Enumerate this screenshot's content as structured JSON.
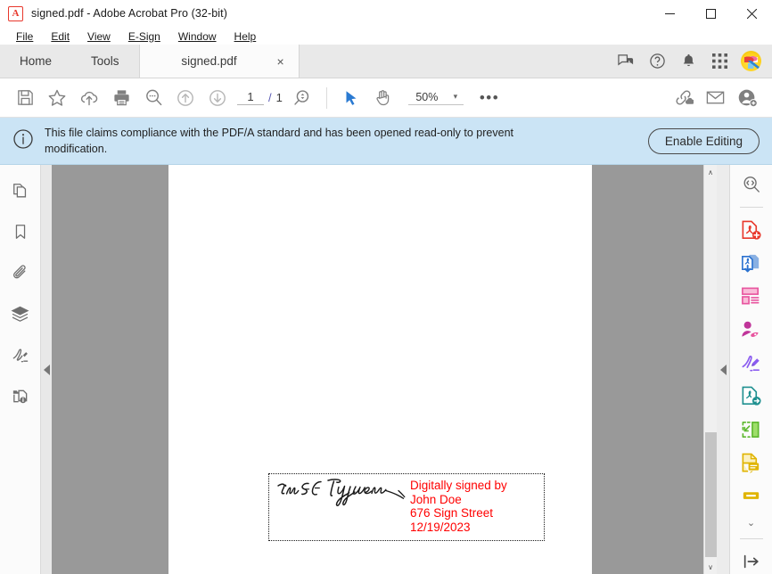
{
  "window": {
    "title": "signed.pdf - Adobe Acrobat Pro (32-bit)",
    "logo_glyph": "A",
    "minimize": "—",
    "maximize": "☐",
    "close": "✕"
  },
  "menubar": {
    "items": [
      {
        "label": "File",
        "accel": "F"
      },
      {
        "label": "Edit",
        "accel": "E"
      },
      {
        "label": "View",
        "accel": "V"
      },
      {
        "label": "E-Sign",
        "accel": "S"
      },
      {
        "label": "Window",
        "accel": "W"
      },
      {
        "label": "Help",
        "accel": "H"
      }
    ]
  },
  "tabs": {
    "home": "Home",
    "tools": "Tools",
    "document": "signed.pdf",
    "close_glyph": "×",
    "right_icons": [
      {
        "name": "feedback-icon"
      },
      {
        "name": "help-icon"
      },
      {
        "name": "notification-bell-icon"
      },
      {
        "name": "apps-grid-icon"
      },
      {
        "name": "user-avatar"
      }
    ]
  },
  "toolbar": {
    "save_label": "Save",
    "star_label": "Add to favorites",
    "upload_label": "Save to cloud",
    "print_label": "Print",
    "find_label": "Find",
    "prev_label": "Previous page",
    "next_label": "Next page",
    "page_current": "1",
    "page_separator": "/",
    "page_total": "1",
    "pagezoom_label": "Page view",
    "select_label": "Select tool",
    "hand_label": "Hand tool",
    "zoom_level": "50%",
    "zoom_caret": "▾",
    "more_label": "•••",
    "share_link_label": "Share link",
    "email_label": "Send by email",
    "add_person_label": "Request signatures"
  },
  "notification": {
    "icon": "info-icon",
    "message": "This file claims compliance with the PDF/A standard and has been opened read-only to prevent modification.",
    "button_label": "Enable Editing"
  },
  "left_rail": {
    "items": [
      {
        "name": "page-thumbnails-icon",
        "label": "Page thumbnails"
      },
      {
        "name": "bookmarks-icon",
        "label": "Bookmarks"
      },
      {
        "name": "attachments-icon",
        "label": "Attachments"
      },
      {
        "name": "layers-icon",
        "label": "Layers"
      },
      {
        "name": "signatures-icon",
        "label": "Signatures"
      },
      {
        "name": "document-info-icon",
        "label": "Document properties"
      }
    ]
  },
  "right_rail": {
    "items": [
      {
        "name": "compare-search-icon",
        "label": "Search",
        "color": "#6e6e6e"
      },
      {
        "name": "create-pdf-icon",
        "label": "Create PDF",
        "color": "#e8382c"
      },
      {
        "name": "export-pdf-icon",
        "label": "Export PDF",
        "color": "#2b72d0"
      },
      {
        "name": "organize-pages-icon",
        "label": "Organize Pages",
        "color": "#e8559f"
      },
      {
        "name": "redact-icon",
        "label": "Redact",
        "color": "#c0359a"
      },
      {
        "name": "fill-sign-icon",
        "label": "Fill & Sign",
        "color": "#8b5cf0"
      },
      {
        "name": "protect-icon",
        "label": "Protect",
        "color": "#1f9090"
      },
      {
        "name": "optimize-pdf-icon",
        "label": "Optimize PDF",
        "color": "#5db82e"
      },
      {
        "name": "comment-icon",
        "label": "Comment",
        "color": "#e0b400"
      },
      {
        "name": "more-tools-icon",
        "label": "More tools",
        "color": "#e0b400"
      }
    ],
    "chevron": "⌄",
    "collapse_label": "Collapse panel"
  },
  "document": {
    "page_background": "#ffffff",
    "canvas_background": "#999999",
    "signature": {
      "handwritten_name": "Tim E Typer",
      "lines": [
        "Digitally signed by",
        "John Doe",
        "676 Sign Street",
        "12/19/2023"
      ],
      "text_color": "#ff0000"
    }
  },
  "scrollbar": {
    "up_glyph": "∧",
    "down_glyph": "∨"
  }
}
